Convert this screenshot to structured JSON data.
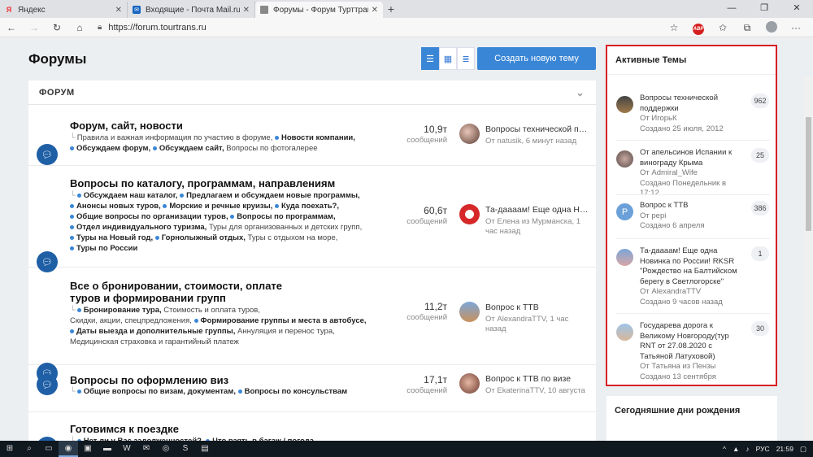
{
  "browser": {
    "tabs": [
      {
        "label": "Яндекс",
        "icon": "yandex-icon",
        "active": false
      },
      {
        "label": "Входящие - Почта Mail.ru",
        "icon": "mail-icon",
        "active": false
      },
      {
        "label": "Форумы - Форум Турттранс-Вол",
        "icon": "forum-icon",
        "active": true
      }
    ],
    "url": "https://forum.tourtrans.ru"
  },
  "page": {
    "title": "Форумы",
    "create_button": "Создать новую тему",
    "section_title": "ФОРУМ"
  },
  "forums": [
    {
      "title": "Форум, сайт, новости",
      "subforums": [
        {
          "text": "Правила и важная информация по участию в форуме,",
          "bold": false,
          "dot": false,
          "branch": true
        },
        {
          "text": "Новости компании,",
          "bold": true,
          "dot": true
        },
        {
          "text": "Обсуждаем форум,",
          "bold": true,
          "dot": true,
          "br": true
        },
        {
          "text": "Обсуждаем сайт,",
          "bold": true,
          "dot": true
        },
        {
          "text": "Вопросы по фотогалерее",
          "bold": false,
          "dot": false
        }
      ],
      "count": "10,9т",
      "count_label": "сообщений",
      "last_title": "Вопросы технической под...",
      "last_meta": "От natusik, 6 минут назад"
    },
    {
      "title": "Вопросы по каталогу, программам, направлениям",
      "subforums": [
        {
          "text": "Обсуждаем наш каталог,",
          "bold": true,
          "dot": true,
          "branch": true
        },
        {
          "text": "Предлагаем и обсуждаем новые программы,",
          "bold": true,
          "dot": true
        },
        {
          "text": "Анонсы новых туров,",
          "bold": true,
          "dot": true,
          "br": true
        },
        {
          "text": "Морские и речные круизы,",
          "bold": true,
          "dot": true
        },
        {
          "text": "Куда поехать?,",
          "bold": true,
          "dot": true
        },
        {
          "text": "Общие вопросы по организации туров,",
          "bold": true,
          "dot": true,
          "br": true
        },
        {
          "text": "Вопросы по программам,",
          "bold": true,
          "dot": true
        },
        {
          "text": "Отдел индивидуального туризма,",
          "bold": true,
          "dot": true,
          "br": true
        },
        {
          "text": "Туры для организованных и детских групп,",
          "bold": false,
          "dot": false
        },
        {
          "text": "Туры на Новый год,",
          "bold": true,
          "dot": true,
          "br": true
        },
        {
          "text": "Горнолыжный отдых,",
          "bold": true,
          "dot": true
        },
        {
          "text": "Туры с отдыхом на море,",
          "bold": false,
          "dot": false
        },
        {
          "text": "Туры по России",
          "bold": true,
          "dot": true,
          "br": true
        }
      ],
      "count": "60,6т",
      "count_label": "сообщений",
      "last_title": "Та-даааам! Еще одна Нов...",
      "last_meta": "От Елена из Мурманска, 1 час назад"
    },
    {
      "title": "Все о бронировании, стоимости, оплате туров и формировании групп",
      "subforums": [
        {
          "text": "Бронирование тура,",
          "bold": true,
          "dot": true,
          "branch": true
        },
        {
          "text": "Стоимость и оплата туров,",
          "bold": false,
          "dot": false
        },
        {
          "text": "Скидки, акции, спецпредложения,",
          "bold": false,
          "dot": false,
          "br": true
        },
        {
          "text": "Формирование группы и места в автобусе,",
          "bold": true,
          "dot": true
        },
        {
          "text": "Даты выезда и дополнительные группы,",
          "bold": true,
          "dot": true,
          "br": true
        },
        {
          "text": "Аннуляция и перенос тура,",
          "bold": false,
          "dot": false
        },
        {
          "text": "Медицинская страховка и гарантийный платеж",
          "bold": false,
          "dot": false,
          "br": true
        }
      ],
      "count": "11,2т",
      "count_label": "сообщений",
      "last_title": "Вопрос к ТТВ",
      "last_meta": "От AlexandraTTV, 1 час назад"
    },
    {
      "title": "Вопросы по оформлению виз",
      "subforums": [
        {
          "text": "Общие вопросы по визам, документам,",
          "bold": true,
          "dot": true,
          "branch": true
        },
        {
          "text": "Вопросы по консульствам",
          "bold": true,
          "dot": true
        }
      ],
      "count": "17,1т",
      "count_label": "сообщений",
      "last_title": "Вопрос к ТТВ по визе",
      "last_meta": "От EkaterinaTTV, 10 августа"
    },
    {
      "title": "Готовимся к поездке",
      "subforums": [
        {
          "text": "Нет ли у Вас задолженностей?,",
          "bold": true,
          "dot": true,
          "branch": true
        },
        {
          "text": "Что взять в багаж / погода,",
          "bold": true,
          "dot": true
        }
      ],
      "count": "",
      "count_label": "",
      "last_title": "",
      "last_meta": ""
    }
  ],
  "sidebar": {
    "title": "Активные Темы",
    "topics": [
      {
        "title": "Вопросы технической поддержки",
        "author": "От ИгорьК",
        "created": "Создано 25 июля, 2012",
        "count": "962",
        "avatar": "photo"
      },
      {
        "title": "От апельсинов Испании к винограду Крыма",
        "author": "От Admiral_Wife",
        "created": "Создано Понедельник в 17:12",
        "count": "25",
        "avatar": "photo"
      },
      {
        "title": "Вопрос к ТТВ",
        "author": "От pepi",
        "created": "Создано 6 апреля",
        "count": "386",
        "avatar": "P"
      },
      {
        "title": "Та-даааам! Еще одна Новинка по России! RKSR \"Рождество на Балтийском берегу в Светлогорске\"",
        "author": "От AlexandraTTV",
        "created": "Создано 9 часов назад",
        "count": "1",
        "avatar": "photo"
      },
      {
        "title": "Государева дорога к Великому Новгороду(тур RNT от 27.08.2020 с Татьяной Латуховой)",
        "author": "От Татьяна из Пензы",
        "created": "Создано 13 сентября",
        "count": "30",
        "avatar": "photo"
      }
    ],
    "birthdays_title": "Сегодняшние дни рождения"
  },
  "taskbar": {
    "lang": "РУС",
    "time": "21:59"
  },
  "colors": {
    "accent": "#3a86d6",
    "forum_icon": "#1f5fa5",
    "highlight_border": "#d81f26"
  }
}
